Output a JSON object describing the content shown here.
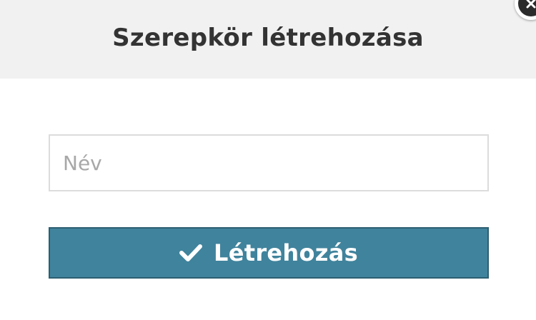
{
  "dialog": {
    "title": "Szerepkör létrehozása",
    "name_field": {
      "placeholder": "Név",
      "value": ""
    },
    "create_button": {
      "label": "Létrehozás",
      "icon": "check-icon",
      "color": "#40839c"
    },
    "close_button": {
      "icon": "close-icon"
    }
  }
}
